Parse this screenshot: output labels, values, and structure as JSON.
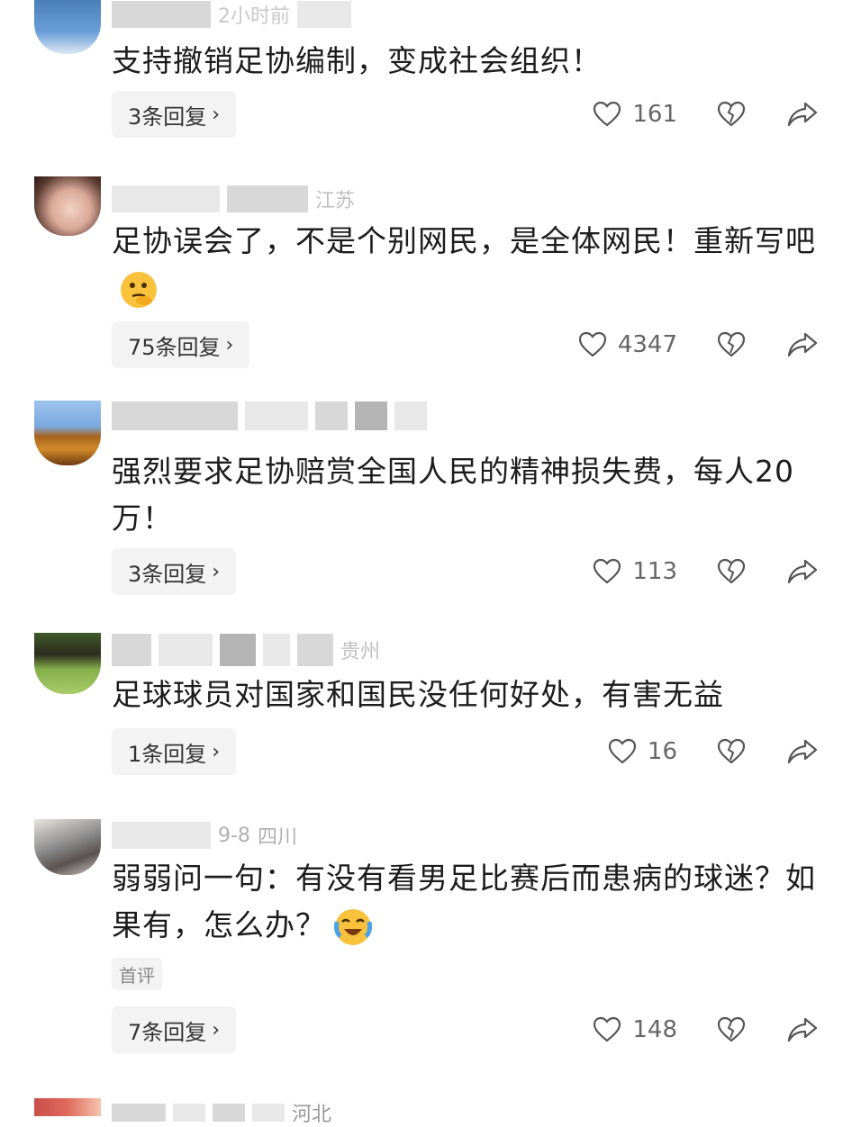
{
  "comments": [
    {
      "meta_visible": "2小时前",
      "text": "支持撤销足协编制，变成社会组织！",
      "replies": "3条回复",
      "likes": "161"
    },
    {
      "meta_visible": "江苏",
      "text": "足协误会了，不是个别网民，是全体网民！重新写吧",
      "replies": "75条回复",
      "likes": "4347"
    },
    {
      "meta_visible": "",
      "text": "强烈要求足协赔赏全国人民的精神损失费，每人20万！",
      "replies": "3条回复",
      "likes": "113"
    },
    {
      "meta_visible": "贵州",
      "text": "足球球员对国家和国民没任何好处，有害无益",
      "replies": "1条回复",
      "likes": "16"
    },
    {
      "meta_date": "9-8",
      "meta_visible": "四川",
      "text": "弱弱问一句：有没有看男足比赛后而患病的球迷？如果有，怎么办？",
      "badge": "首评",
      "replies": "7条回复",
      "likes": "148"
    },
    {
      "meta_visible": "河北"
    }
  ],
  "icons": {
    "like": "heart-outline-icon",
    "dislike": "broken-heart-icon",
    "share": "share-arrow-icon"
  }
}
